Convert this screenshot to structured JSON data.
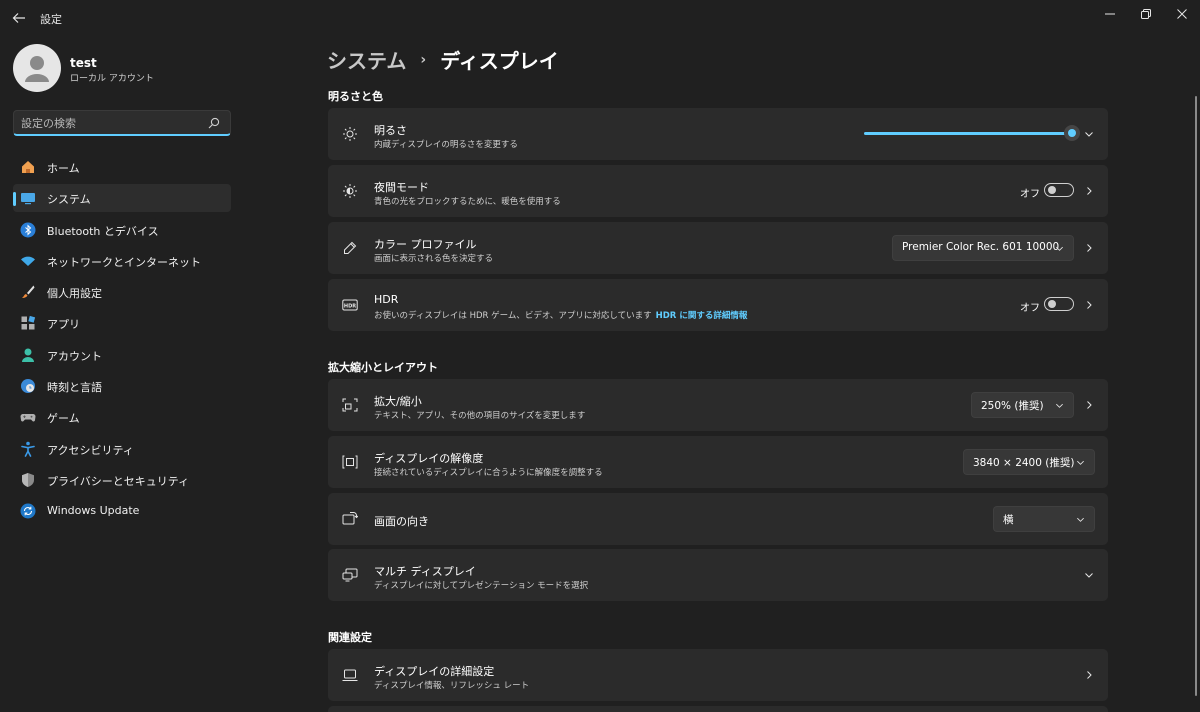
{
  "window": {
    "app_title": "設定",
    "minimize_icon": "minimize-icon",
    "maximize_icon": "restore-icon",
    "close_icon": "close-icon"
  },
  "user": {
    "name": "test",
    "account_type": "ローカル アカウント"
  },
  "search": {
    "placeholder": "設定の検索",
    "value": ""
  },
  "nav": {
    "items": [
      {
        "label": "ホーム",
        "icon": "home-icon",
        "active": false
      },
      {
        "label": "システム",
        "icon": "system-icon",
        "active": true
      },
      {
        "label": "Bluetooth とデバイス",
        "icon": "bluetooth-icon",
        "active": false
      },
      {
        "label": "ネットワークとインターネット",
        "icon": "wifi-icon",
        "active": false
      },
      {
        "label": "個人用設定",
        "icon": "brush-icon",
        "active": false
      },
      {
        "label": "アプリ",
        "icon": "apps-icon",
        "active": false
      },
      {
        "label": "アカウント",
        "icon": "account-icon",
        "active": false
      },
      {
        "label": "時刻と言語",
        "icon": "time-language-icon",
        "active": false
      },
      {
        "label": "ゲーム",
        "icon": "gamepad-icon",
        "active": false
      },
      {
        "label": "アクセシビリティ",
        "icon": "accessibility-icon",
        "active": false
      },
      {
        "label": "プライバシーとセキュリティ",
        "icon": "shield-icon",
        "active": false
      },
      {
        "label": "Windows Update",
        "icon": "windows-update-icon",
        "active": false
      }
    ]
  },
  "breadcrumb": {
    "parent": "システム",
    "separator": "›",
    "current": "ディスプレイ"
  },
  "sections": {
    "brightness_color": "明るさと色",
    "scale_layout": "拡大縮小とレイアウト",
    "related": "関連設定"
  },
  "cards": {
    "brightness": {
      "title": "明るさ",
      "desc": "内蔵ディスプレイの明るさを変更する",
      "value": 100
    },
    "night_light": {
      "title": "夜間モード",
      "desc": "青色の光をブロックするために、暖色を使用する",
      "state": "オフ"
    },
    "color_profile": {
      "title": "カラー プロファイル",
      "desc": "画面に表示される色を決定する",
      "selected": "Premier Color Rec. 601 10000"
    },
    "hdr": {
      "title": "HDR",
      "desc": "お使いのディスプレイは HDR ゲーム、ビデオ、アプリに対応しています",
      "link": "HDR に関する詳細情報",
      "state": "オフ"
    },
    "scale": {
      "title": "拡大/縮小",
      "desc": "テキスト、アプリ、その他の項目のサイズを変更します",
      "selected": "250% (推奨)"
    },
    "resolution": {
      "title": "ディスプレイの解像度",
      "desc": "接続されているディスプレイに合うように解像度を調整する",
      "selected": "3840 × 2400 (推奨)"
    },
    "orientation": {
      "title": "画面の向き",
      "selected": "横"
    },
    "multi_display": {
      "title": "マルチ ディスプレイ",
      "desc": "ディスプレイに対してプレゼンテーション モードを選択"
    },
    "advanced_display": {
      "title": "ディスプレイの詳細設定",
      "desc": "ディスプレイ情報、リフレッシュ レート"
    }
  },
  "colors": {
    "accent": "#60cdff",
    "background": "#202020",
    "card": "#2b2b2b"
  }
}
